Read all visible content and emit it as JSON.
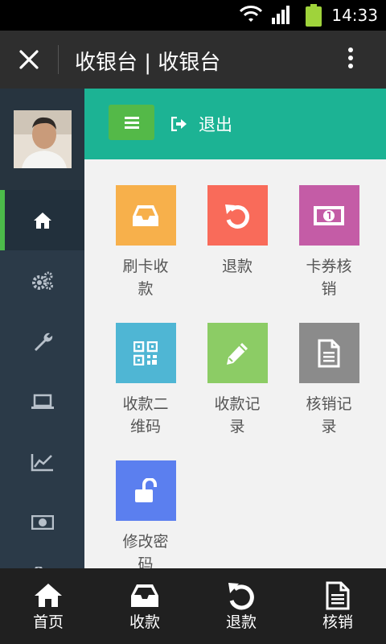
{
  "status_bar": {
    "time": "14:33",
    "icons": [
      "wifi-icon",
      "signal-icon",
      "battery-icon"
    ]
  },
  "top_bar": {
    "title": "收银台 | 收银台",
    "close_icon": "close-icon",
    "more_icon": "more-vertical-icon"
  },
  "sidebar": {
    "items": [
      {
        "icon": "home-icon",
        "active": true
      },
      {
        "icon": "gears-icon",
        "active": false
      },
      {
        "icon": "wrench-icon",
        "active": false
      },
      {
        "icon": "laptop-icon",
        "active": false
      },
      {
        "icon": "line-chart-icon",
        "active": false
      },
      {
        "icon": "money-icon",
        "active": false
      },
      {
        "icon": "unlock-icon",
        "active": false
      }
    ]
  },
  "header": {
    "menu_icon": "menu-icon",
    "logout_label": "退出"
  },
  "tiles": [
    {
      "label": "刷卡收款",
      "icon": "inbox-icon",
      "color": "#f7b04b"
    },
    {
      "label": "退款",
      "icon": "undo-icon",
      "color": "#f96b5a"
    },
    {
      "label": "卡券核销",
      "icon": "money-icon",
      "color": "#c45ca6"
    },
    {
      "label": "收款二维码",
      "icon": "qrcode-icon",
      "color": "#4fb6d4"
    },
    {
      "label": "收款记录",
      "icon": "pencil-icon",
      "color": "#8ccc65"
    },
    {
      "label": "核销记录",
      "icon": "document-icon",
      "color": "#8b8b8b"
    },
    {
      "label": "修改密码",
      "icon": "unlock-icon",
      "color": "#5b7fef"
    }
  ],
  "bottom_nav": [
    {
      "label": "首页",
      "icon": "home-icon"
    },
    {
      "label": "收款",
      "icon": "inbox-icon"
    },
    {
      "label": "退款",
      "icon": "undo-icon"
    },
    {
      "label": "核销",
      "icon": "document-icon"
    }
  ],
  "colors": {
    "header_green": "#1cb394",
    "menu_button": "#54b948",
    "active_indicator": "#4cbb4a",
    "sidebar_bg": "#2b3a48"
  }
}
